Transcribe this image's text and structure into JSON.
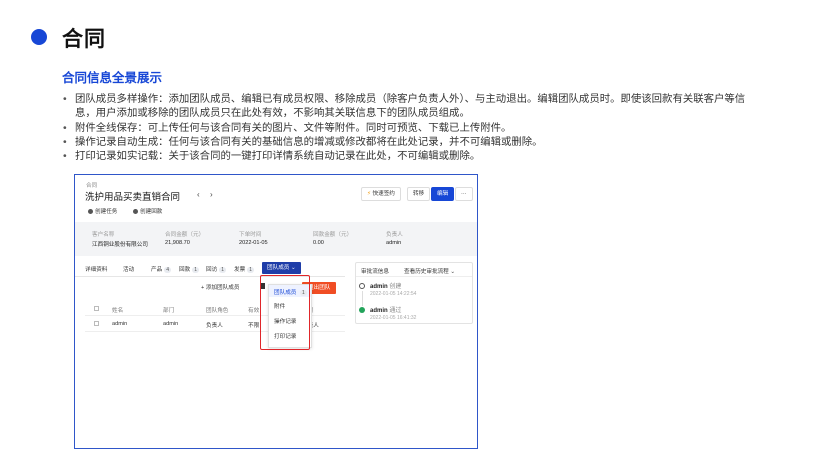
{
  "page": {
    "title": "合同",
    "subtitle": "合同信息全景展示",
    "bullets": [
      "团队成员多样操作：添加团队成员、编辑已有成员权限、移除成员（除客户负责人外）、与主动退出。编辑团队成员时。即使该回款有关联客户等信息，用户添加或移除的团队成员只在此处有效，不影响其关联信息下的团队成员组成。",
      "附件全线保存：可上传任何与该合同有关的图片、文件等附件。同时可预览、下载已上传附件。",
      "操作记录自动生成：任何与该合同有关的基础信息的增减或修改都将在此处记录，并不可编辑或删除。",
      "打印记录如实记载：关于该合同的一键打印详情系统自动记录在此处，不可编辑或删除。"
    ]
  },
  "screenshot": {
    "breadcrumb": "合同",
    "contract_title": "洗护用品买卖直销合同",
    "prev_arrow": "‹",
    "next_arrow": "›",
    "quick_sign": "快速签约",
    "transfer": "转移",
    "edit": "编辑",
    "more": "···",
    "create_task": "创建任务",
    "create_payment": "创建回款",
    "info": {
      "labels": [
        "客户名称",
        "合同金额（元）",
        "下单时间",
        "回款金额（元）",
        "负责人"
      ],
      "values": [
        "江西铜业股份有限公司",
        "21,908.70",
        "2022-01-05",
        "0.00",
        "admin"
      ]
    },
    "tabs": [
      {
        "label": "详细资料",
        "badge": ""
      },
      {
        "label": "活动",
        "badge": ""
      },
      {
        "label": "产品",
        "badge": "4"
      },
      {
        "label": "回款",
        "badge": "1"
      },
      {
        "label": "回访",
        "badge": "1"
      },
      {
        "label": "发票",
        "badge": "1"
      }
    ],
    "active_tab": "团队成员",
    "add_member": "添加团队成员",
    "exit_team": "退出团队",
    "table": {
      "headers": [
        "姓名",
        "部门",
        "团队角色",
        "有效",
        "权限"
      ],
      "rows": [
        [
          "admin",
          "admin",
          "负责人",
          "不限",
          "负责人"
        ]
      ]
    },
    "dropdown": {
      "items": [
        {
          "label": "团队成员",
          "badge": "1"
        },
        {
          "label": "附件",
          "badge": ""
        },
        {
          "label": "操作记录",
          "badge": ""
        },
        {
          "label": "打印记录",
          "badge": ""
        }
      ]
    },
    "approval": {
      "title": "审批流信息",
      "history": "查看历史审批流程",
      "steps": [
        {
          "name": "admin",
          "action": "创建",
          "time": "2022-01-05 14:22:54"
        },
        {
          "name": "admin",
          "action": "通过",
          "time": "2022-01-05 16:41:32"
        }
      ]
    },
    "colors": {
      "accent": "#1747d6",
      "danger": "#f04d24",
      "highlight_box": "#e0262a"
    }
  }
}
